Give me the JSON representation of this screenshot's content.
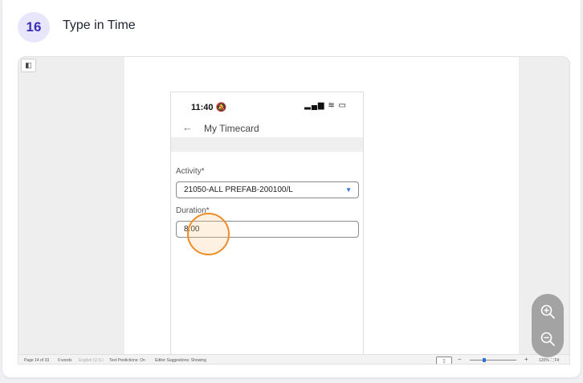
{
  "step": {
    "number": "16",
    "title": "Type in Time"
  },
  "phone": {
    "time": "11:40",
    "nav_title": "My Timecard",
    "activity_label": "Activity*",
    "activity_value": "21050-ALL PREFAB-200100/L",
    "duration_label": "Duration*",
    "duration_value": "8.00"
  },
  "status_bar": {
    "page": "Page 14 of 33",
    "words": "0 words",
    "language": "English (U.S.)",
    "text_predictions": "Text Predictions: On",
    "editor_suggestions": "Editor Suggestions: Showing",
    "zoom": "120%",
    "fit": "Fit"
  },
  "icons": {
    "sidebar_toggle": "sidebar-icon",
    "bell": "bell-slash-icon",
    "signal": "signal-icon",
    "wifi": "wifi-icon",
    "battery": "battery-icon",
    "back": "arrow-left-icon",
    "dropdown": "caret-down-icon",
    "zoom_in": "zoom-in-icon",
    "zoom_out": "zoom-out-icon"
  },
  "colors": {
    "badge_bg": "#e8e6fb",
    "badge_text": "#3b2fb5",
    "click_ring": "#f08a24",
    "accent_blue": "#2a6fd6"
  }
}
